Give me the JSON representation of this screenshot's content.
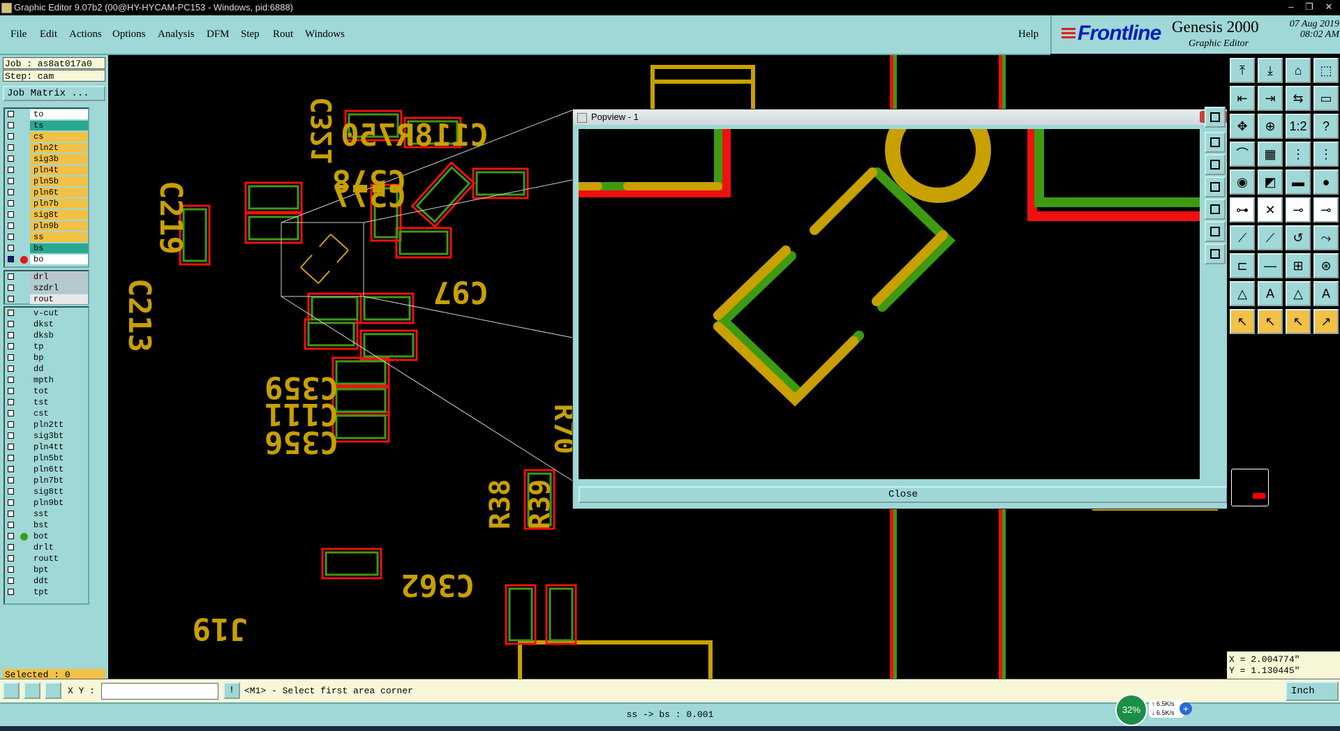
{
  "window": {
    "title": "Graphic Editor 9.07b2 (00@HY-HYCAM-PC153 - Windows, pid:6888)",
    "buttons": [
      "–",
      "❐",
      "✕"
    ]
  },
  "menu": [
    "File",
    "Edit",
    "Actions",
    "Options",
    "Analysis",
    "DFM",
    "Step",
    "Rout",
    "Windows"
  ],
  "help_label": "Help",
  "brand": {
    "logo": "Frontline",
    "product": "Genesis 2000",
    "subtitle": "Graphic Editor",
    "date": "07 Aug 2019",
    "time": "08:02 AM"
  },
  "left": {
    "job": "Job : as8at017a0",
    "step": "Step: cam",
    "job_matrix": "Job Matrix ...",
    "group1": [
      {
        "name": "to",
        "bg": "#ffffff",
        "mark": "⬋"
      },
      {
        "name": "ts",
        "bg": "#2aa88f"
      },
      {
        "name": "cs",
        "bg": "#f2c145"
      },
      {
        "name": "pln2t",
        "bg": "#f2c145"
      },
      {
        "name": "sig3b",
        "bg": "#f2c145"
      },
      {
        "name": "pln4t",
        "bg": "#f2c145"
      },
      {
        "name": "pln5b",
        "bg": "#f2c145"
      },
      {
        "name": "pln6t",
        "bg": "#f2c145"
      },
      {
        "name": "pln7b",
        "bg": "#f2c145"
      },
      {
        "name": "sig8t",
        "bg": "#f2c145"
      },
      {
        "name": "pln9b",
        "bg": "#f2c145"
      },
      {
        "name": "ss",
        "bg": "#f2c145"
      },
      {
        "name": "bs",
        "bg": "#2aa88f"
      },
      {
        "name": "bo",
        "bg": "#ffffff",
        "mark": "⬋≡",
        "dot": "#e01a1a",
        "filled": true
      }
    ],
    "group2": [
      {
        "name": "drl",
        "bg": "#b9c6cc"
      },
      {
        "name": "szdrl",
        "bg": "#b9c6cc"
      },
      {
        "name": "rout",
        "bg": "#e8e8e8"
      }
    ],
    "group3": [
      {
        "name": "v-cut",
        "bg": "#9fd8d6"
      },
      {
        "name": "dkst",
        "bg": "#9fd8d6"
      },
      {
        "name": "dksb",
        "bg": "#9fd8d6"
      },
      {
        "name": "tp",
        "bg": "#9fd8d6"
      },
      {
        "name": "bp",
        "bg": "#9fd8d6"
      },
      {
        "name": "dd",
        "bg": "#9fd8d6"
      },
      {
        "name": "mpth",
        "bg": "#9fd8d6"
      },
      {
        "name": "tot",
        "bg": "#9fd8d6",
        "mark": "⬋"
      },
      {
        "name": "tst",
        "bg": "#9fd8d6"
      },
      {
        "name": "cst",
        "bg": "#9fd8d6"
      },
      {
        "name": "pln2tt",
        "bg": "#9fd8d6"
      },
      {
        "name": "sig3bt",
        "bg": "#9fd8d6"
      },
      {
        "name": "pln4tt",
        "bg": "#9fd8d6"
      },
      {
        "name": "pln5bt",
        "bg": "#9fd8d6"
      },
      {
        "name": "pln6tt",
        "bg": "#9fd8d6"
      },
      {
        "name": "pln7bt",
        "bg": "#9fd8d6"
      },
      {
        "name": "sig8tt",
        "bg": "#9fd8d6"
      },
      {
        "name": "pln9bt",
        "bg": "#9fd8d6"
      },
      {
        "name": "sst",
        "bg": "#9fd8d6"
      },
      {
        "name": "bst",
        "bg": "#9fd8d6"
      },
      {
        "name": "bot",
        "bg": "#9fd8d6",
        "mark": "⬋",
        "dot": "#3c9c1a"
      },
      {
        "name": "drlt",
        "bg": "#9fd8d6"
      },
      {
        "name": "routt",
        "bg": "#9fd8d6"
      },
      {
        "name": "bpt",
        "bg": "#9fd8d6"
      },
      {
        "name": "ddt",
        "bg": "#9fd8d6"
      },
      {
        "name": "tpt",
        "bg": "#9fd8d6"
      }
    ],
    "selected": "Selected : 0"
  },
  "canvas_labels": [
    "C118R750",
    "C578",
    "C577",
    "C219",
    "C321",
    "C213",
    "C97",
    "C359",
    "C111",
    "C356",
    "C362",
    "J19",
    "R38",
    "R39",
    "R70"
  ],
  "colors": {
    "silkscreen": "#c8a000",
    "pad_outline": "#f01010",
    "trace_green": "#3d9a12",
    "panel_cyan": "#9fd8d6",
    "layer_yellow": "#f2c145"
  },
  "popview": {
    "title": "Popview - 1",
    "close_label": "Close",
    "close_x": "✕"
  },
  "right": {
    "coord_x": "X = 2.004774\"",
    "coord_y": "Y = 1.130445\""
  },
  "bottom": {
    "xy_label": "X Y :",
    "xy_value": "",
    "prompt_button": "!",
    "prompt": "<M1> - Select first area corner",
    "unit": "Inch",
    "status": "ss -> bs : 0.001",
    "net_percent": "32%",
    "net_up": "6.5K/s",
    "net_down": "6.5K/s"
  }
}
